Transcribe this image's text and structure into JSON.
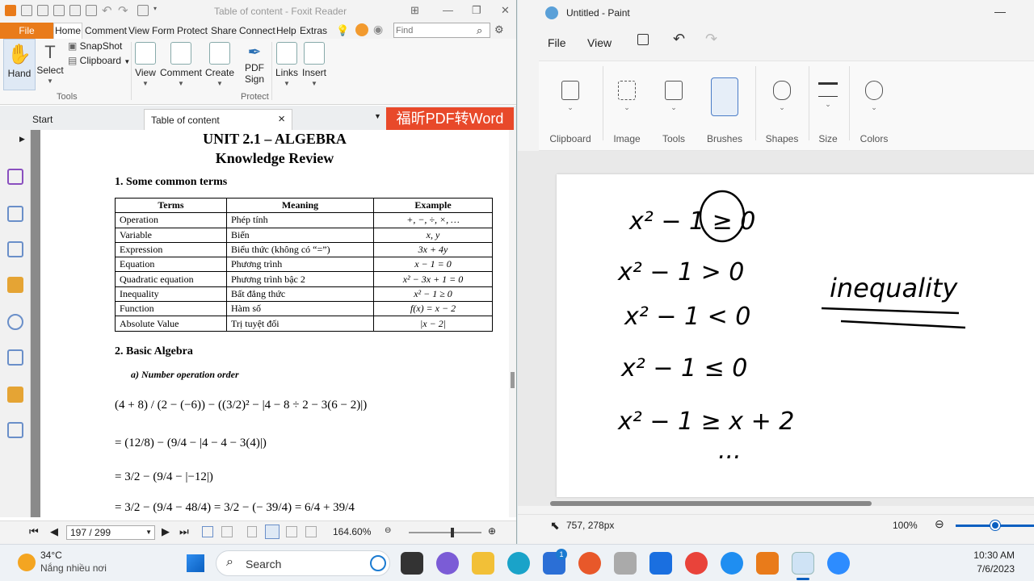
{
  "foxit": {
    "title": "Table of content - Foxit Reader",
    "menu": {
      "file": "File",
      "items": [
        "Home",
        "Comment",
        "View",
        "Form",
        "Protect",
        "Share",
        "Connect",
        "Help",
        "Extras"
      ]
    },
    "find_placeholder": "Find",
    "ribbon": {
      "hand": "Hand",
      "select": "Select",
      "snapshot": "SnapShot",
      "clipboard": "Clipboard",
      "view": "View",
      "comment": "Comment",
      "create": "Create",
      "pdf_sign_1": "PDF",
      "pdf_sign_2": "Sign",
      "links": "Links",
      "insert": "Insert",
      "group_tools": "Tools",
      "group_protect": "Protect"
    },
    "tabs": {
      "start": "Start",
      "doc": "Table of content",
      "close": "×"
    },
    "banner": "福昕PDF转Word",
    "document": {
      "title1": "UNIT 2.1 – ALGEBRA",
      "title2": "Knowledge Review",
      "section1": "1. Some common terms",
      "table": {
        "headers": [
          "Terms",
          "Meaning",
          "Example"
        ],
        "rows": [
          [
            "Operation",
            "Phép tính",
            "+, −, ÷, ×, …"
          ],
          [
            "Variable",
            "Biến",
            "x, y"
          ],
          [
            "Expression",
            "Biểu thức (không có “=”)",
            "3x + 4y"
          ],
          [
            "Equation",
            "Phương trình",
            "x − 1 = 0"
          ],
          [
            "Quadratic equation",
            "Phương trình bậc 2",
            "x² − 3x + 1 = 0"
          ],
          [
            "Inequality",
            "Bất đẳng thức",
            "x² − 1 ≥ 0"
          ],
          [
            "Function",
            "Hàm số",
            "f(x) = x − 2"
          ],
          [
            "Absolute Value",
            "Trị tuyệt đối",
            "|x − 2|"
          ]
        ]
      },
      "section2": "2. Basic Algebra",
      "subsection": "a)  Number operation order",
      "math": [
        "(4 + 8) / (2 − (−6)) − ((3/2)² − |4 − 8 ÷ 2 − 3(6 − 2)|)",
        "= (12/8) − (9/4 − |4 − 4 − 3(4)|)",
        "= 3/2 − (9/4 − |−12|)",
        "= 3/2 − (9/4 − 48/4) = 3/2 − (− 39/4) = 6/4 + 39/4"
      ]
    },
    "status": {
      "page": "197 / 299",
      "zoom": "164.60%"
    }
  },
  "paint": {
    "title": "Untitled - Paint",
    "menu": [
      "File",
      "View"
    ],
    "groups": [
      "Clipboard",
      "Image",
      "Tools",
      "Brushes",
      "Shapes",
      "Size",
      "Colors"
    ],
    "canvas_text": {
      "line1": "x² − 1 ≥ 0",
      "line2": "x² − 1 > 0",
      "line3": "x² − 1 < 0",
      "line4": "x² − 1 ≤ 0",
      "line5": "x² − 1 ≥ x + 2",
      "line6": "...",
      "note": "inequality"
    },
    "status": {
      "coords": "757, 278px",
      "zoom": "100%"
    }
  },
  "taskbar": {
    "weather_temp": "34°C",
    "weather_desc": "Nắng nhiều nơi",
    "search": "Search",
    "time": "10:30 AM",
    "date": "7/6/2023",
    "badge": "1"
  },
  "colors": {
    "foxit_orange": "#e97b1a",
    "banner_red": "#e8492a",
    "paint_accent": "#0a5fc0"
  }
}
